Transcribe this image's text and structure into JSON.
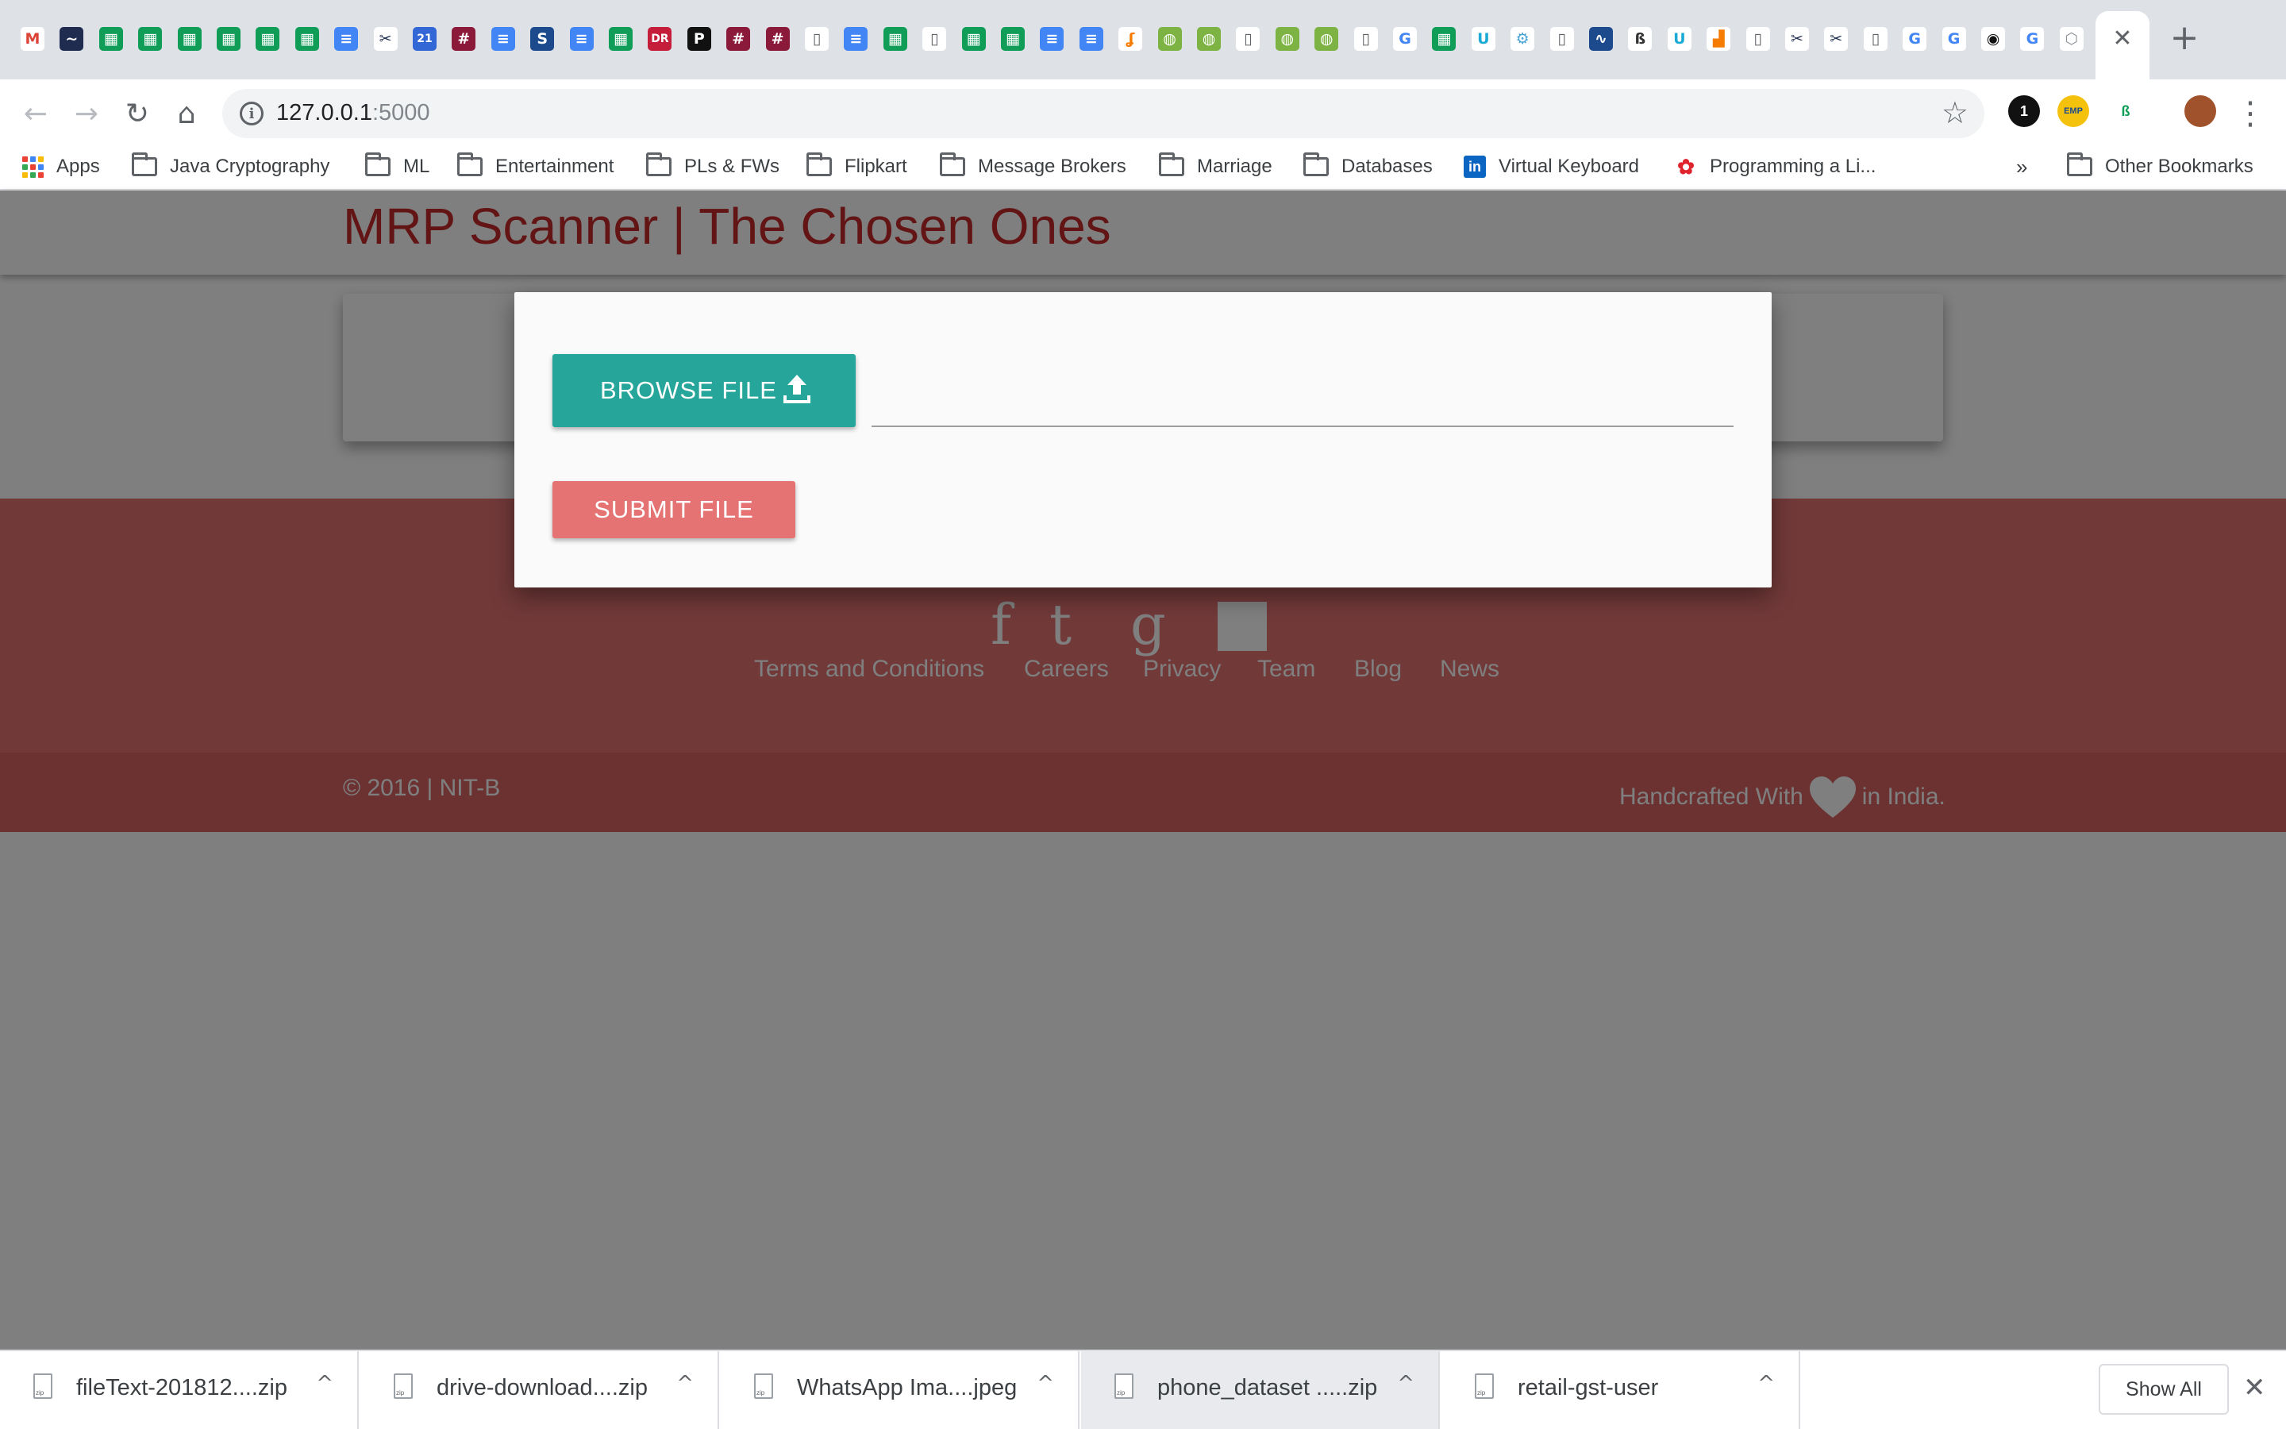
{
  "browser": {
    "tab_favicons": [
      {
        "icon": "gmail-icon",
        "glyph": "M",
        "color": "#db4437",
        "bg": "#ffffff"
      },
      {
        "icon": "site-icon",
        "glyph": "~",
        "color": "#ffffff",
        "bg": "#1f2c4f"
      },
      {
        "icon": "sheets-icon",
        "glyph": "▦",
        "color": "#ffffff",
        "bg": "#0f9d58"
      },
      {
        "icon": "sheets-icon",
        "glyph": "▦",
        "color": "#ffffff",
        "bg": "#0f9d58"
      },
      {
        "icon": "sheets-icon",
        "glyph": "▦",
        "color": "#ffffff",
        "bg": "#0f9d58"
      },
      {
        "icon": "sheets-icon",
        "glyph": "▦",
        "color": "#ffffff",
        "bg": "#0f9d58"
      },
      {
        "icon": "sheets-icon",
        "glyph": "▦",
        "color": "#ffffff",
        "bg": "#0f9d58"
      },
      {
        "icon": "sheets-icon",
        "glyph": "▦",
        "color": "#ffffff",
        "bg": "#0f9d58"
      },
      {
        "icon": "docs-icon",
        "glyph": "≡",
        "color": "#ffffff",
        "bg": "#4285f4"
      },
      {
        "icon": "scissors-icon",
        "glyph": "✂",
        "color": "#1f2c4f",
        "bg": "#ffffff"
      },
      {
        "icon": "calendar-icon",
        "glyph": "21",
        "color": "#ffffff",
        "bg": "#3367d6"
      },
      {
        "icon": "hashtag-icon",
        "glyph": "#",
        "color": "#ffffff",
        "bg": "#8b1a3a"
      },
      {
        "icon": "docs-icon",
        "glyph": "≡",
        "color": "#ffffff",
        "bg": "#4285f4"
      },
      {
        "icon": "s-icon",
        "glyph": "S",
        "color": "#ffffff",
        "bg": "#1c4a8c"
      },
      {
        "icon": "docs-icon",
        "glyph": "≡",
        "color": "#ffffff",
        "bg": "#4285f4"
      },
      {
        "icon": "sheets-icon",
        "glyph": "▦",
        "color": "#ffffff",
        "bg": "#0f9d58"
      },
      {
        "icon": "dr-icon",
        "glyph": "DR",
        "color": "#ffffff",
        "bg": "#c41e3a"
      },
      {
        "icon": "p-icon",
        "glyph": "P",
        "color": "#ffffff",
        "bg": "#111111"
      },
      {
        "icon": "hashtag-icon",
        "glyph": "#",
        "color": "#ffffff",
        "bg": "#8b1a3a"
      },
      {
        "icon": "hashtag-icon",
        "glyph": "#",
        "color": "#ffffff",
        "bg": "#8b1a3a"
      },
      {
        "icon": "file-icon",
        "glyph": "▯",
        "color": "#5f6368",
        "bg": "#ffffff"
      },
      {
        "icon": "docs-icon",
        "glyph": "≡",
        "color": "#ffffff",
        "bg": "#4285f4"
      },
      {
        "icon": "sheets-icon",
        "glyph": "▦",
        "color": "#ffffff",
        "bg": "#0f9d58"
      },
      {
        "icon": "file-icon",
        "glyph": "▯",
        "color": "#5f6368",
        "bg": "#ffffff"
      },
      {
        "icon": "sheets-icon",
        "glyph": "▦",
        "color": "#ffffff",
        "bg": "#0f9d58"
      },
      {
        "icon": "sheets-icon",
        "glyph": "▦",
        "color": "#ffffff",
        "bg": "#0f9d58"
      },
      {
        "icon": "docs-icon",
        "glyph": "≡",
        "color": "#ffffff",
        "bg": "#4285f4"
      },
      {
        "icon": "docs-icon",
        "glyph": "≡",
        "color": "#ffffff",
        "bg": "#4285f4"
      },
      {
        "icon": "flame-icon",
        "glyph": "ʆ",
        "color": "#f57c00",
        "bg": "#ffffff"
      },
      {
        "icon": "globe-icon",
        "glyph": "◍",
        "color": "#ffffff",
        "bg": "#7cb342"
      },
      {
        "icon": "globe-icon",
        "glyph": "◍",
        "color": "#ffffff",
        "bg": "#7cb342"
      },
      {
        "icon": "file-icon",
        "glyph": "▯",
        "color": "#5f6368",
        "bg": "#ffffff"
      },
      {
        "icon": "globe-icon",
        "glyph": "◍",
        "color": "#ffffff",
        "bg": "#7cb342"
      },
      {
        "icon": "globe-icon",
        "glyph": "◍",
        "color": "#ffffff",
        "bg": "#7cb342"
      },
      {
        "icon": "file-icon",
        "glyph": "▯",
        "color": "#5f6368",
        "bg": "#ffffff"
      },
      {
        "icon": "google-icon",
        "glyph": "G",
        "color": "#4285f4",
        "bg": "#ffffff"
      },
      {
        "icon": "sheets-icon",
        "glyph": "▦",
        "color": "#ffffff",
        "bg": "#0f9d58"
      },
      {
        "icon": "udemy-icon",
        "glyph": "U",
        "color": "#1ba9d6",
        "bg": "#ffffff"
      },
      {
        "icon": "gear-icon",
        "glyph": "⚙",
        "color": "#4aa3d8",
        "bg": "#ffffff"
      },
      {
        "icon": "file-icon",
        "glyph": "▯",
        "color": "#5f6368",
        "bg": "#ffffff"
      },
      {
        "icon": "wave-icon",
        "glyph": "∿",
        "color": "#ffffff",
        "bg": "#1c4a8c"
      },
      {
        "icon": "lock-icon",
        "glyph": "ß",
        "color": "#333333",
        "bg": "#ffffff"
      },
      {
        "icon": "udemy-icon",
        "glyph": "U",
        "color": "#1ba9d6",
        "bg": "#ffffff"
      },
      {
        "icon": "chart-icon",
        "glyph": "▟",
        "color": "#f57c00",
        "bg": "#ffffff"
      },
      {
        "icon": "file-icon",
        "glyph": "▯",
        "color": "#5f6368",
        "bg": "#ffffff"
      },
      {
        "icon": "scissors-icon",
        "glyph": "✂",
        "color": "#1f2c4f",
        "bg": "#ffffff"
      },
      {
        "icon": "scissors-icon",
        "glyph": "✂",
        "color": "#1f2c4f",
        "bg": "#ffffff"
      },
      {
        "icon": "file-icon",
        "glyph": "▯",
        "color": "#5f6368",
        "bg": "#ffffff"
      },
      {
        "icon": "google-icon",
        "glyph": "G",
        "color": "#4285f4",
        "bg": "#ffffff"
      },
      {
        "icon": "google-icon",
        "glyph": "G",
        "color": "#4285f4",
        "bg": "#ffffff"
      },
      {
        "icon": "github-icon",
        "glyph": "◉",
        "color": "#111111",
        "bg": "#ffffff"
      },
      {
        "icon": "google-icon",
        "glyph": "G",
        "color": "#4285f4",
        "bg": "#ffffff"
      },
      {
        "icon": "settings-icon",
        "glyph": "⬡",
        "color": "#8a8f96",
        "bg": "#ffffff"
      }
    ],
    "close_glyph": "✕",
    "new_tab_glyph": "+",
    "back_glyph": "←",
    "forward_glyph": "→",
    "reload_glyph": "↻",
    "home_glyph": "⌂",
    "info_glyph": "i",
    "star_glyph": "☆",
    "menu_glyph": "⋮",
    "url_host": "127.0.0.1",
    "url_port": ":5000",
    "extensions": [
      {
        "icon": "onepassword-icon",
        "glyph": "1",
        "bg": "#111111",
        "color": "#ffffff"
      },
      {
        "icon": "emp-icon",
        "glyph": "EMP",
        "bg": "#f4c20d",
        "color": "#1c4a8c"
      },
      {
        "icon": "extension-icon",
        "glyph": "ß",
        "bg": "#ffffff",
        "color": "#0f9d58"
      },
      {
        "icon": "profile-avatar-icon",
        "glyph": "",
        "bg": "#a0522d",
        "color": "#ffffff"
      }
    ],
    "bookmarks": {
      "apps_label": "Apps",
      "items": [
        {
          "label": "Java Cryptography",
          "type": "folder"
        },
        {
          "label": "ML",
          "type": "folder"
        },
        {
          "label": "Entertainment",
          "type": "folder"
        },
        {
          "label": "PLs & FWs",
          "type": "folder"
        },
        {
          "label": "Flipkart",
          "type": "folder"
        },
        {
          "label": "Message Brokers",
          "type": "folder"
        },
        {
          "label": "Marriage",
          "type": "folder"
        },
        {
          "label": "Databases",
          "type": "folder"
        },
        {
          "label": "Virtual Keyboard",
          "type": "linkedin"
        },
        {
          "label": "Programming a Li...",
          "type": "huawei"
        }
      ],
      "overflow_label": "»",
      "other_label": "Other Bookmarks"
    }
  },
  "site": {
    "title": "MRP Scanner | The Chosen Ones",
    "social_glyphs": [
      "f",
      "t",
      "g"
    ],
    "footer_links": [
      "Terms and Conditions",
      "Careers",
      "Privacy",
      "Team",
      "Blog",
      "News"
    ],
    "copyright": "© 2016 | NIT-B",
    "handcrafted_prefix": "Handcrafted With",
    "handcrafted_suffix": "in India."
  },
  "modal": {
    "browse_label": "BROWSE FILE",
    "file_path_value": "",
    "submit_label": "SUBMIT FILE"
  },
  "downloads": {
    "items": [
      {
        "name": "fileText-201812....zip",
        "highlight": false
      },
      {
        "name": "drive-download....zip",
        "highlight": false
      },
      {
        "name": "WhatsApp Ima....jpeg",
        "highlight": false
      },
      {
        "name": "phone_dataset .....zip",
        "highlight": true
      },
      {
        "name": "retail-gst-user",
        "highlight": false
      }
    ],
    "caret_glyph": "^",
    "show_all_label": "Show All",
    "close_glyph": "✕"
  },
  "colors": {
    "accent_teal": "#26a69a",
    "accent_red": "#e57373",
    "title_red": "#c62828"
  }
}
